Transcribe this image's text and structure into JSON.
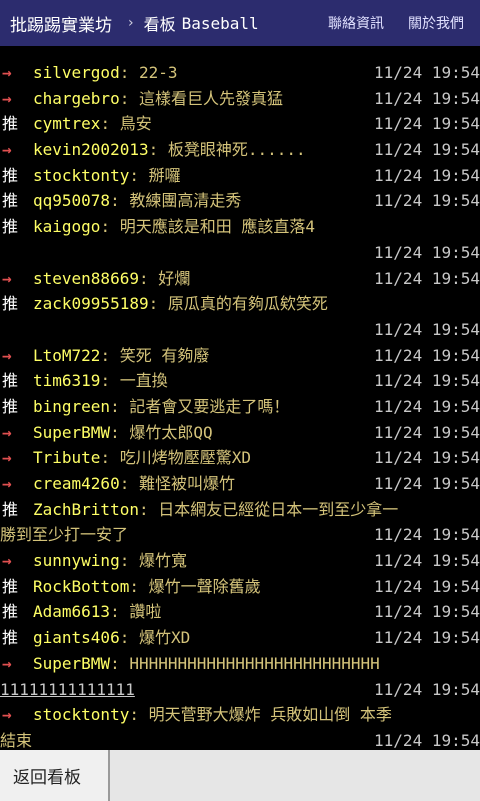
{
  "header": {
    "site_title": "批踢踢實業坊",
    "breadcrumb_sep": "›",
    "board_label": "看板",
    "board_name": "Baseball",
    "contact_link": "聯絡資訊",
    "about_link": "關於我們"
  },
  "pushes": [
    {
      "tag": "→",
      "user": "silvergod",
      "content": ": 22-3",
      "time": "11/24 19:54"
    },
    {
      "tag": "→",
      "user": "chargebro",
      "content": ": 這樣看巨人先發真猛",
      "time": "11/24 19:54"
    },
    {
      "tag": "推",
      "user": "cymtrex",
      "content": ": 鳥安",
      "time": "11/24 19:54"
    },
    {
      "tag": "→",
      "user": "kevin2002013",
      "content": ": 板凳眼神死......",
      "time": "11/24 19:54"
    },
    {
      "tag": "推",
      "user": "stocktonty",
      "content": ": 掰囉",
      "time": "11/24 19:54"
    },
    {
      "tag": "推",
      "user": "qq950078",
      "content": ": 教練團高清走秀",
      "time": "11/24 19:54"
    },
    {
      "tag": "推",
      "user": "kaigogo",
      "content": ": 明天應該是和田 應該直落4",
      "time": "",
      "cont": "",
      "cont_time": "11/24 19:54"
    },
    {
      "tag": "→",
      "user": "steven88669",
      "content": ": 好爛",
      "time": "11/24 19:54"
    },
    {
      "tag": "推",
      "user": "zack09955189",
      "content": ": 原瓜真的有夠瓜欸笑死",
      "time": "",
      "cont": "",
      "cont_time": "11/24 19:54"
    },
    {
      "tag": "→",
      "user": "LtoM722",
      "content": ": 笑死 有夠廢",
      "time": "11/24 19:54"
    },
    {
      "tag": "推",
      "user": "tim6319",
      "content": ": 一直換",
      "time": "11/24 19:54"
    },
    {
      "tag": "推",
      "user": "bingreen",
      "content": ": 記者會又要逃走了嗎！",
      "time": "11/24 19:54"
    },
    {
      "tag": "→",
      "user": "SuperBMW",
      "content": ": 爆竹太郎QQ",
      "time": "11/24 19:54"
    },
    {
      "tag": "→",
      "user": "Tribute",
      "content": ": 吃川烤物壓壓驚XD",
      "time": "11/24 19:54"
    },
    {
      "tag": "→",
      "user": "cream4260",
      "content": ": 難怪被叫爆竹",
      "time": "11/24 19:54"
    },
    {
      "tag": "推",
      "user": "ZachBritton",
      "content": ": 日本網友已經從日本一到至少拿一",
      "time": "",
      "cont": "勝到至少打一安了",
      "cont_time": "11/24 19:54"
    },
    {
      "tag": "→",
      "user": "sunnywing",
      "content": ": 爆竹寬",
      "time": "11/24 19:54"
    },
    {
      "tag": "推",
      "user": "RockBottom",
      "content": ": 爆竹一聲除舊歲",
      "time": "11/24 19:54"
    },
    {
      "tag": "推",
      "user": "Adam6613",
      "content": ": 讚啦",
      "time": "11/24 19:54"
    },
    {
      "tag": "推",
      "user": "giants406",
      "content": ": 爆竹XD",
      "time": "11/24 19:54"
    },
    {
      "tag": "→",
      "user": "SuperBMW",
      "content": ": HHHHHHHHHHHHHHHHHHHHHHHHHH",
      "time": "",
      "cont": "11111111111111",
      "cont_link": true,
      "cont_time": "11/24 19:54"
    },
    {
      "tag": "→",
      "user": "stocktonty",
      "content": ": 明天菅野大爆炸 兵敗如山倒 本季",
      "time": "",
      "cont": "結束",
      "cont_time": "11/24 19:54"
    }
  ],
  "footer": {
    "back_label": "返回看板"
  }
}
